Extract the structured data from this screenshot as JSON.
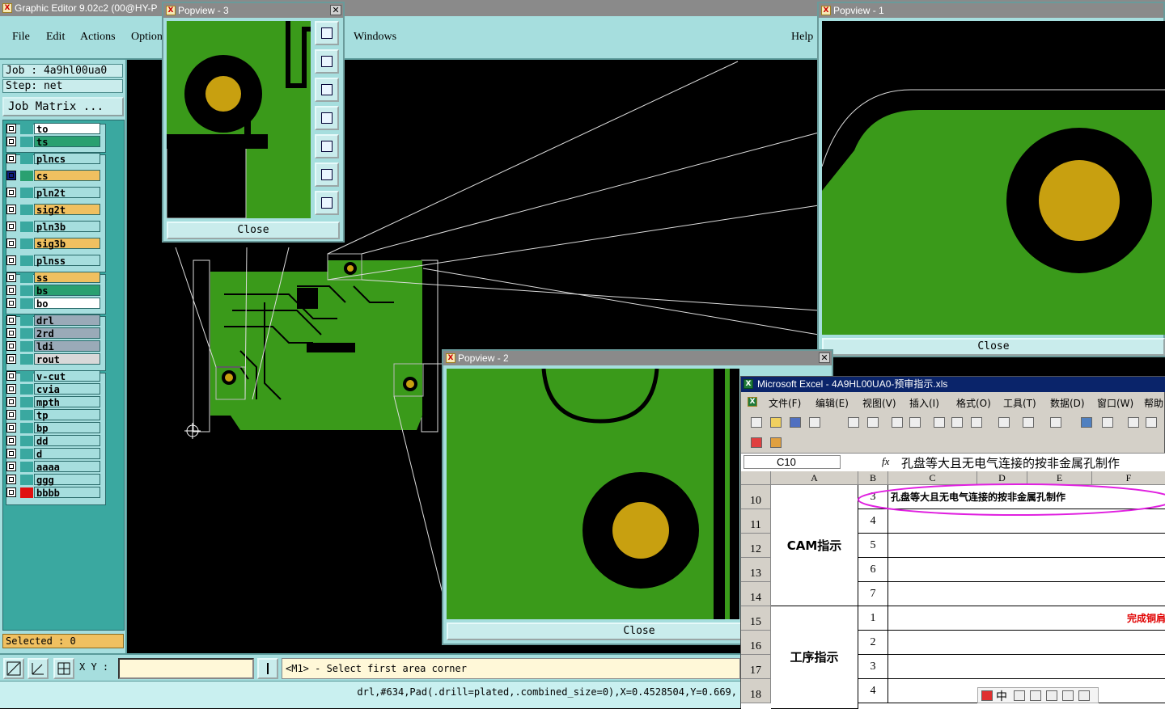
{
  "app": {
    "title": "Graphic Editor 9.02c2 (00@HY-P",
    "menu": [
      "File",
      "Edit",
      "Actions",
      "Option",
      "Windows",
      "Help"
    ]
  },
  "job": {
    "job_label": "Job : 4a9hl00ua0",
    "step_label": "Step: net",
    "job_matrix": "Job Matrix ..."
  },
  "layers": [
    {
      "name": "to",
      "bg": "#ffffff",
      "color": "#3aa8a0"
    },
    {
      "name": "ts",
      "bg": "#2aa070",
      "color": "#3aa8a0"
    },
    {
      "name": "plncs",
      "bg": "#a6dede",
      "color": "#3aa8a0"
    },
    {
      "name": "cs",
      "bg": "#f0c060",
      "color": "#2aa070"
    },
    {
      "name": "pln2t",
      "bg": "#a6dede",
      "color": "#3aa8a0"
    },
    {
      "name": "sig2t",
      "bg": "#f0c060",
      "color": "#3aa8a0"
    },
    {
      "name": "pln3b",
      "bg": "#a6dede",
      "color": "#3aa8a0"
    },
    {
      "name": "sig3b",
      "bg": "#f0c060",
      "color": "#3aa8a0"
    },
    {
      "name": "plnss",
      "bg": "#a6dede",
      "color": "#3aa8a0"
    },
    {
      "name": "ss",
      "bg": "#f0c060",
      "color": "#3aa8a0"
    },
    {
      "name": "bs",
      "bg": "#2aa070",
      "color": "#3aa8a0"
    },
    {
      "name": "bo",
      "bg": "#ffffff",
      "color": "#3aa8a0"
    },
    {
      "name": "drl",
      "bg": "#9aaab8",
      "color": "#3aa8a0"
    },
    {
      "name": "2rd",
      "bg": "#9aaab8",
      "color": "#3aa8a0"
    },
    {
      "name": "ldi",
      "bg": "#9aaab8",
      "color": "#3aa8a0"
    },
    {
      "name": "rout",
      "bg": "#d8d8d8",
      "color": "#3aa8a0"
    },
    {
      "name": "v-cut",
      "bg": "#a6dede",
      "color": "#3aa8a0"
    },
    {
      "name": "cvia",
      "bg": "#a6dede",
      "color": "#3aa8a0"
    },
    {
      "name": "mpth",
      "bg": "#a6dede",
      "color": "#3aa8a0"
    },
    {
      "name": "tp",
      "bg": "#a6dede",
      "color": "#3aa8a0"
    },
    {
      "name": "bp",
      "bg": "#a6dede",
      "color": "#3aa8a0"
    },
    {
      "name": "dd",
      "bg": "#a6dede",
      "color": "#3aa8a0"
    },
    {
      "name": "d",
      "bg": "#a6dede",
      "color": "#3aa8a0"
    },
    {
      "name": "aaaa",
      "bg": "#a6dede",
      "color": "#3aa8a0"
    },
    {
      "name": "ggg",
      "bg": "#a6dede",
      "color": "#3aa8a0"
    },
    {
      "name": "bbbb",
      "bg": "#a6dede",
      "color": "#e01010"
    }
  ],
  "selected": "Selected : 0",
  "xy_label": "X Y :",
  "prompt": "<M1> - Select first area corner",
  "status": "drl,#634,Pad(.drill=plated,.combined_size=0),X=0.4528504,Y=0.669,",
  "popviews": {
    "p1_title": "Popview - 1",
    "p2_title": "Popview - 2",
    "p3_title": "Popview - 3",
    "close": "Close"
  },
  "excel": {
    "title": "Microsoft Excel - 4A9HL00UA0-预审指示.xls",
    "menu": [
      "文件(F)",
      "编辑(E)",
      "视图(V)",
      "插入(I)",
      "格式(O)",
      "工具(T)",
      "数据(D)",
      "窗口(W)",
      "帮助"
    ],
    "namebox": "C10",
    "fx": "fx",
    "formula": "孔盘等大且无电气连接的按非金属孔制作",
    "columns": [
      "A",
      "B",
      "C",
      "D",
      "E",
      "F"
    ],
    "rows": [
      "10",
      "11",
      "12",
      "13",
      "14",
      "15",
      "16",
      "17",
      "18"
    ],
    "b_values": [
      "3",
      "4",
      "5",
      "6",
      "7",
      "1",
      "2",
      "3",
      "4"
    ],
    "c10": "孔盘等大且无电气连接的按非金属孔制作",
    "c15": "完成铜肩",
    "group1": "CAM指示",
    "group2": "工序指示",
    "ime": "中"
  },
  "colors": {
    "accent": "#a6dede",
    "pcb_green": "#3a9a1a",
    "pad_gold": "#c8a010",
    "xl_blue": "#0a246a"
  }
}
